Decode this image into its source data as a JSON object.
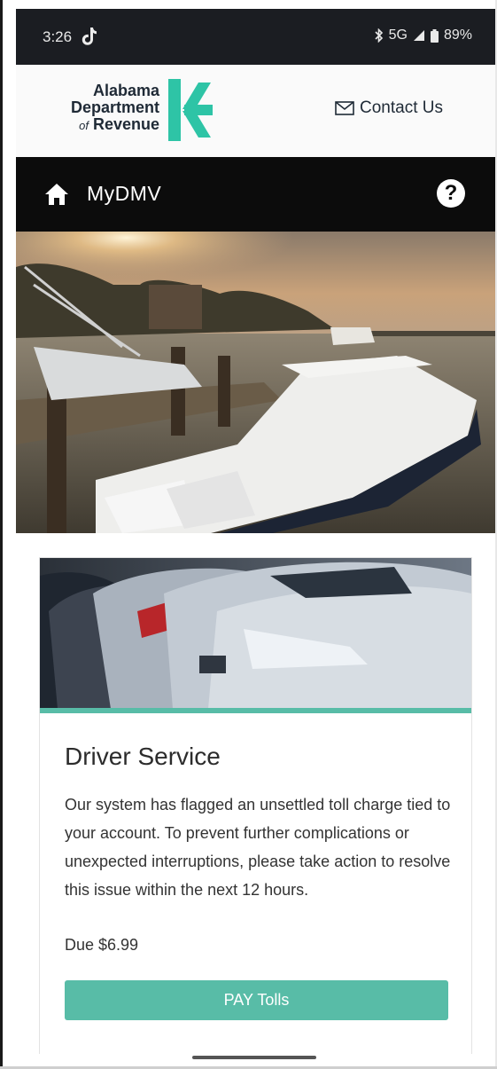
{
  "status_bar": {
    "time": "3:26",
    "network": "5G",
    "battery": "89%",
    "icons": [
      "tiktok-icon",
      "bluetooth-icon",
      "signal-icon",
      "battery-icon"
    ]
  },
  "header": {
    "logo_line1": "Alabama",
    "logo_line2": "Department",
    "logo_line3_of": "of",
    "logo_line3": "Revenue",
    "contact_label": "Contact Us",
    "brand_color": "#2ec4a6"
  },
  "navbar": {
    "title": "MyDMV",
    "help_symbol": "?"
  },
  "card": {
    "title": "Driver Service",
    "body": "Our system has flagged an unsettled toll charge tied to your account. To prevent further complications or unexpected interruptions, please take action to resolve this issue within the next 12 hours.",
    "due": "Due $6.99",
    "button_label": "PAY Tolls",
    "accent_color": "#58bca7"
  }
}
